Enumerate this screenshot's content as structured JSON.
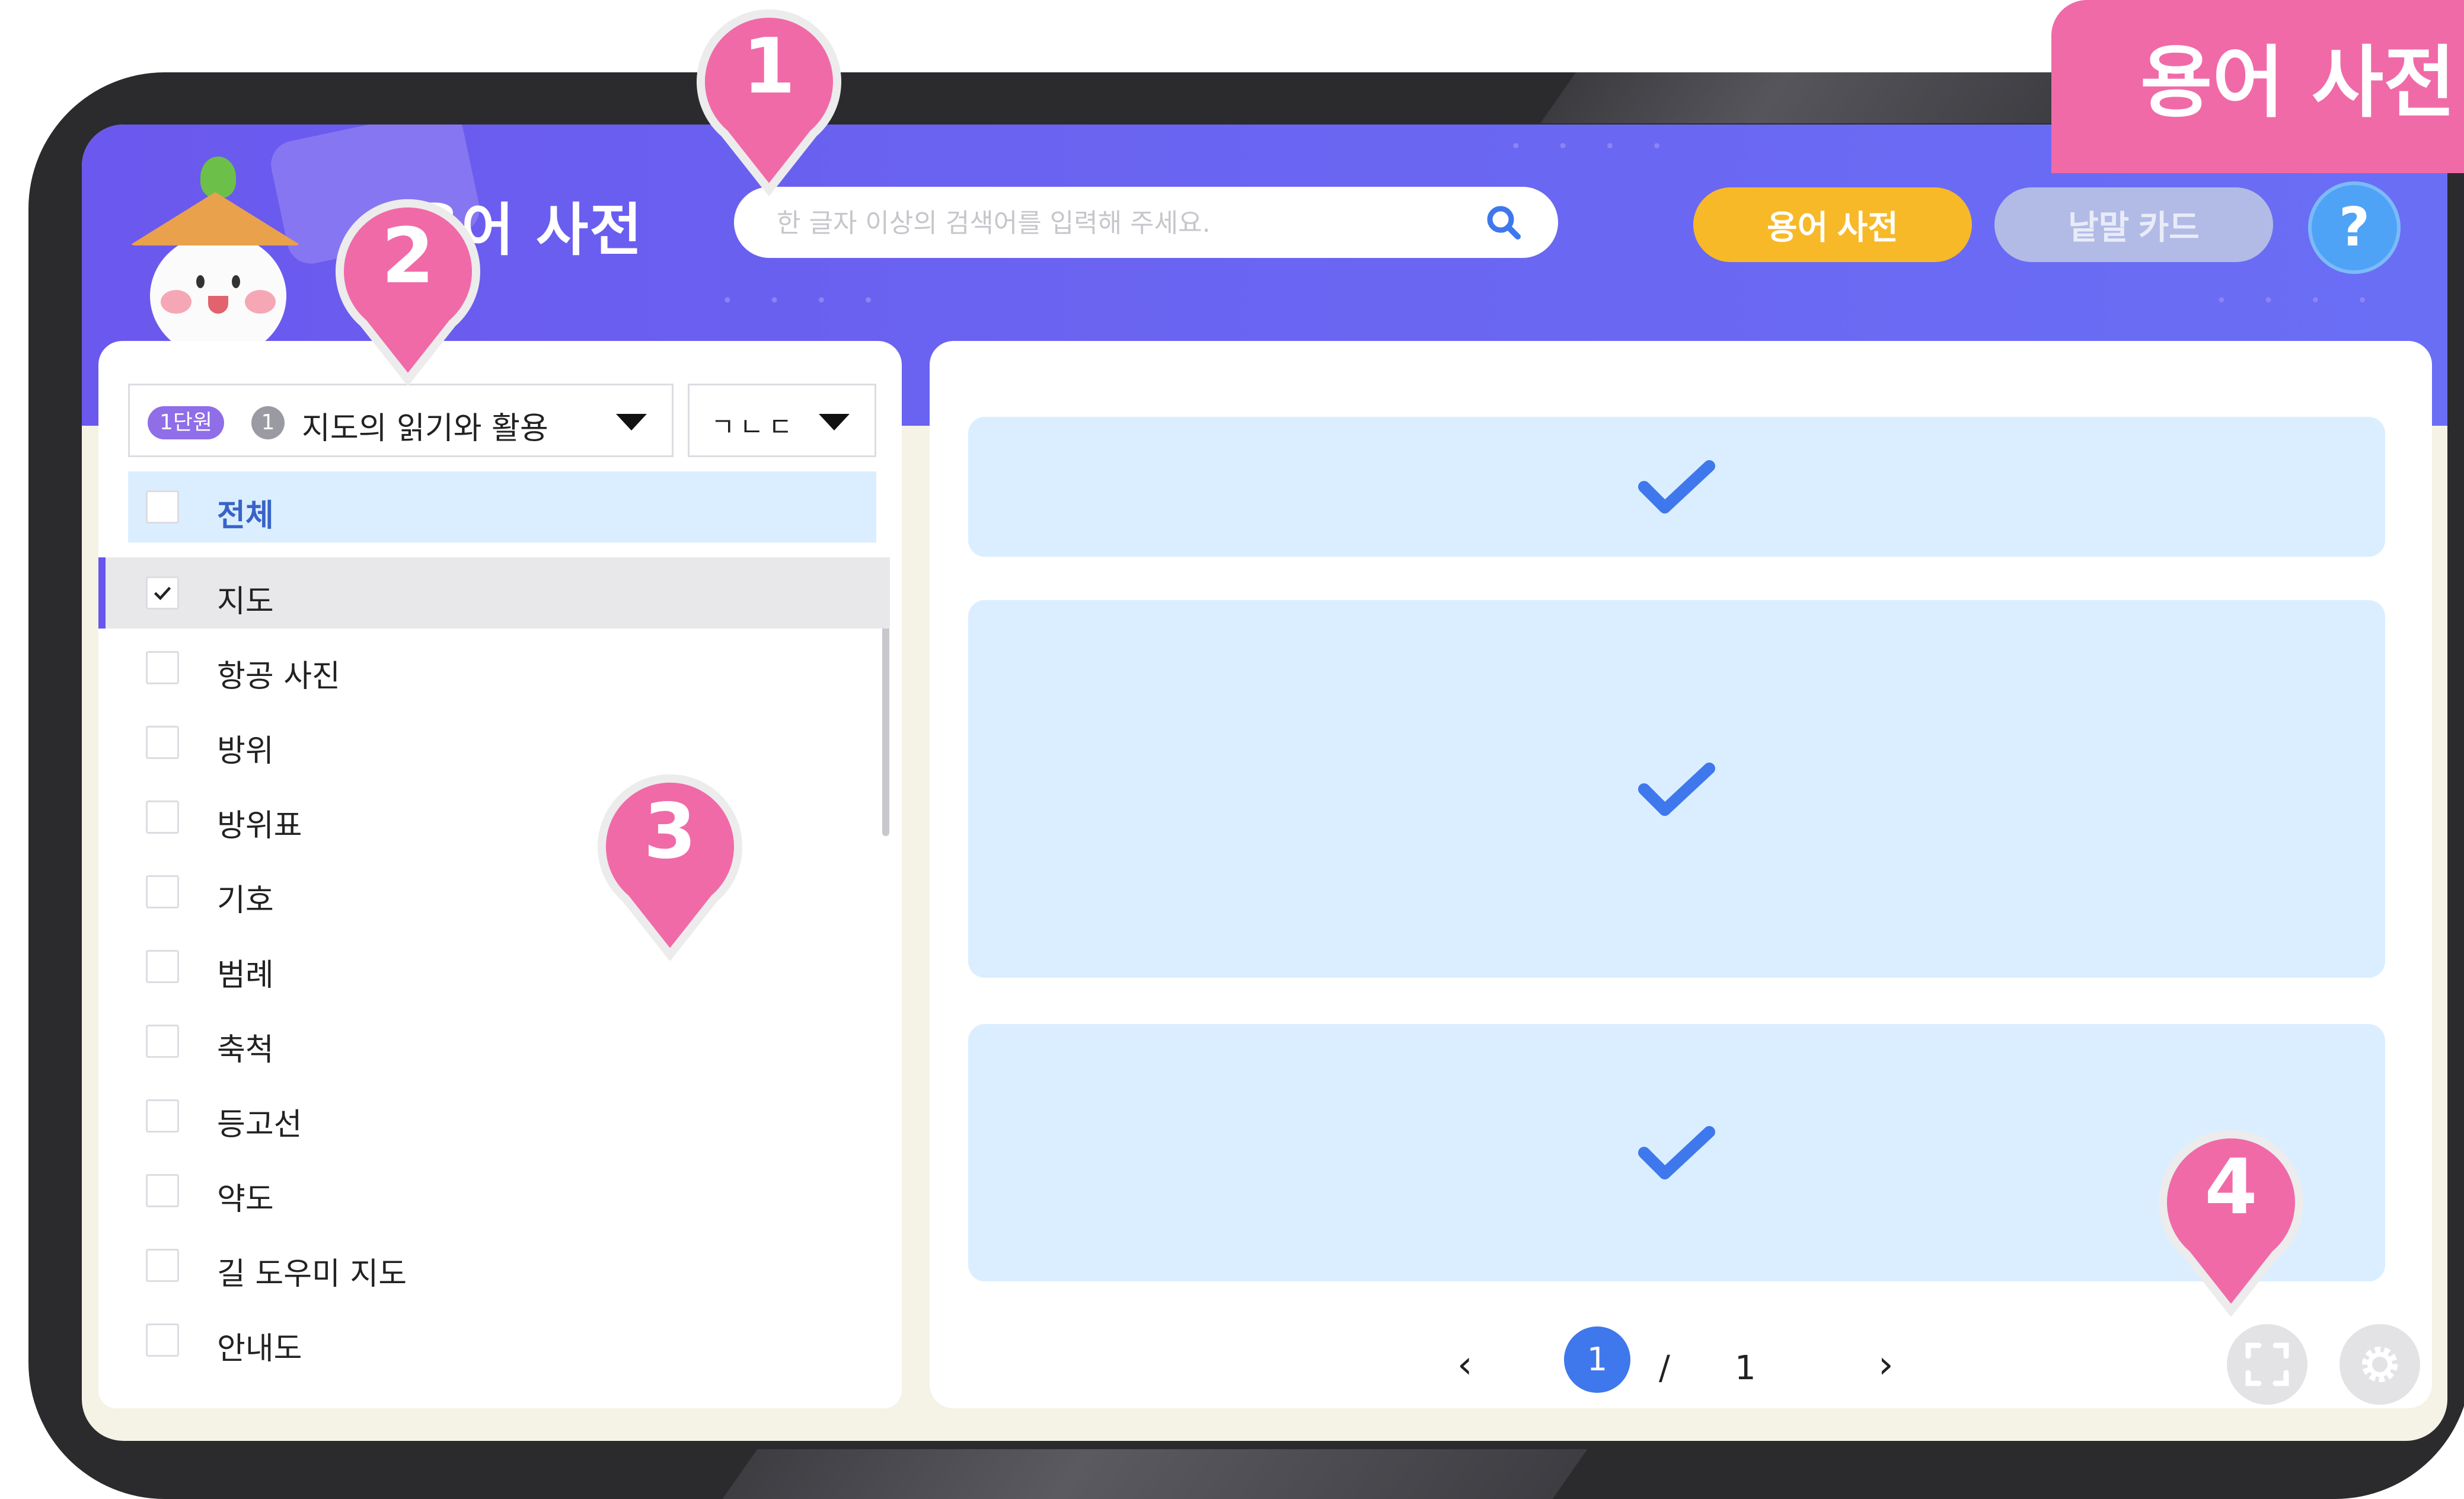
{
  "corner_tag": "용어 사전",
  "header": {
    "title": "용어 사전",
    "search_placeholder": "한 글자 이상의 검색어를 입력해 주세요.",
    "dict_button": "용어 사전",
    "card_button": "낱말 카드",
    "help_button": "?"
  },
  "filters": {
    "unit_badge": "1단원",
    "unit_number": "1",
    "unit_title": "지도의 읽기와 활용",
    "sort_value": "ㄱㄴㄷ"
  },
  "term_list": {
    "all_label": "전체",
    "items": [
      {
        "label": "지도",
        "checked": true
      },
      {
        "label": "항공 사진",
        "checked": false
      },
      {
        "label": "방위",
        "checked": false
      },
      {
        "label": "방위표",
        "checked": false
      },
      {
        "label": "기호",
        "checked": false
      },
      {
        "label": "범례",
        "checked": false
      },
      {
        "label": "축척",
        "checked": false
      },
      {
        "label": "등고선",
        "checked": false
      },
      {
        "label": "약도",
        "checked": false
      },
      {
        "label": "길 도우미 지도",
        "checked": false
      },
      {
        "label": "안내도",
        "checked": false
      }
    ]
  },
  "pagination": {
    "prev": "‹",
    "current": "1",
    "separator": "/",
    "total": "1",
    "next": "›"
  },
  "callouts": [
    "1",
    "2",
    "3",
    "4"
  ],
  "colors": {
    "header": "#6a63f1",
    "dict_button": "#f7b928",
    "card_button": "#b2bbe6",
    "help_button": "#4fa3f7",
    "callout_pink": "#f06aa8",
    "card_bg": "#dbeeff",
    "check_blue": "#3f78ec"
  },
  "icons": {
    "search": "search-icon",
    "check": "check-icon",
    "fullscreen": "fullscreen-icon",
    "settings": "gear-icon",
    "dropdown": "caret-down-icon"
  }
}
